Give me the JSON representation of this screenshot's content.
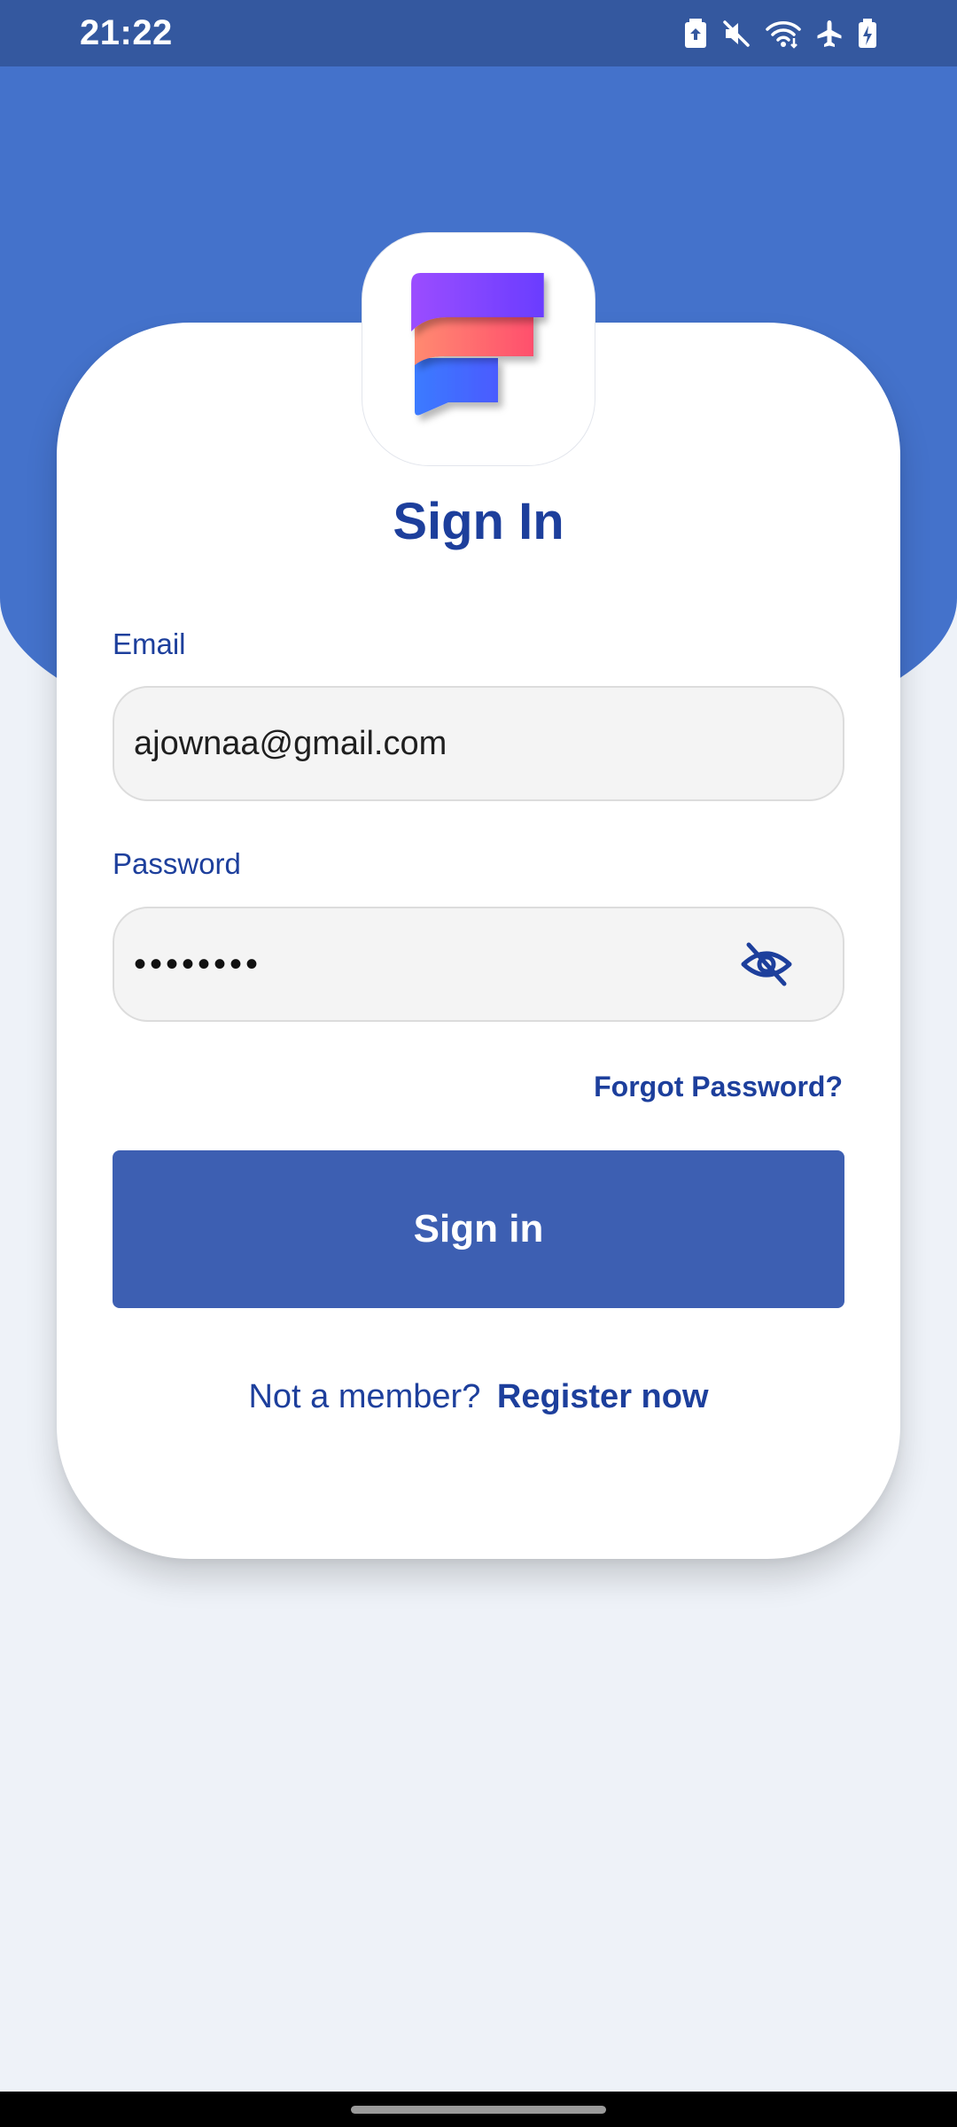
{
  "status_bar": {
    "time": "21:22",
    "icons": [
      "battery-saver-icon",
      "mute-icon",
      "wifi-icon",
      "airplane-icon",
      "battery-charging-icon"
    ]
  },
  "login": {
    "title": "Sign In",
    "email_label": "Email",
    "email_value": "ajownaa@gmail.com",
    "password_label": "Password",
    "password_value": "••••••••",
    "forgot_password": "Forgot Password?",
    "sign_in_button": "Sign in",
    "register_prompt": "Not a member?",
    "register_link": "Register now"
  },
  "colors": {
    "header_blue": "#4472cb",
    "status_bar": "#34589f",
    "primary_text": "#1d3f9c",
    "button": "#3d5fb2",
    "background": "#eef2f8"
  }
}
